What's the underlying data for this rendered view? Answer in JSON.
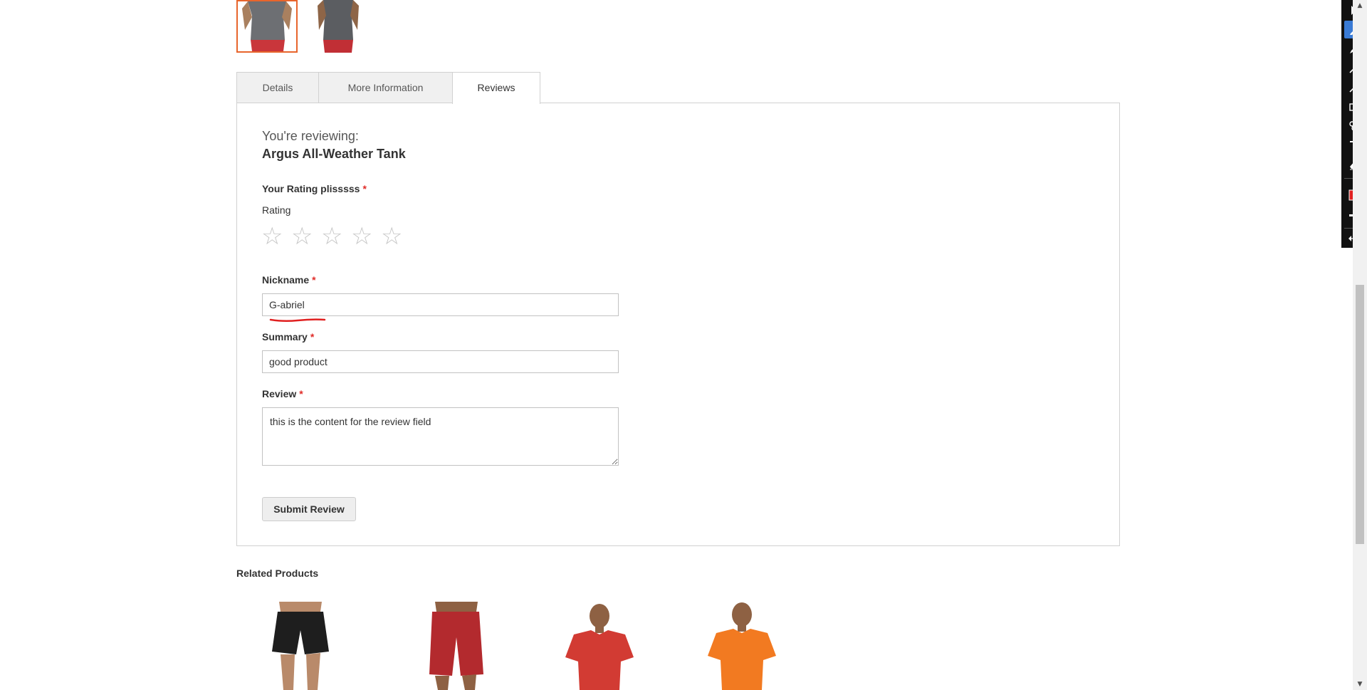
{
  "tabs": [
    {
      "label": "Details"
    },
    {
      "label": "More Information"
    },
    {
      "label": "Reviews"
    }
  ],
  "review_form": {
    "reviewing_prefix": "You're reviewing:",
    "product_name": "Argus All-Weather Tank",
    "rating_heading": "Your Rating plisssss",
    "rating_label": "Rating",
    "required_marker": "*",
    "stars": [
      "☆",
      "☆",
      "☆",
      "☆",
      "☆"
    ],
    "nickname_label": "Nickname",
    "nickname_value": "G-abriel",
    "summary_label": "Summary",
    "summary_value": "good product",
    "review_label": "Review",
    "review_value": "this is the content for the review field",
    "submit_label": "Submit Review"
  },
  "related": {
    "title": "Related Products"
  },
  "toolbar": {
    "tools": [
      "pointer-icon",
      "highlighter-icon",
      "pen-icon",
      "line-icon",
      "arrow-icon",
      "rectangle-icon",
      "stamp-icon",
      "text-icon",
      "eraser-icon",
      "color-swatch",
      "stroke-width-icon",
      "expand-icon"
    ],
    "selected_tool": "highlighter-icon",
    "color": "#e02020",
    "accent_color": "#3a7bd5"
  },
  "colors": {
    "required": "#e02b27",
    "thumb_active_border": "#e8652c"
  }
}
